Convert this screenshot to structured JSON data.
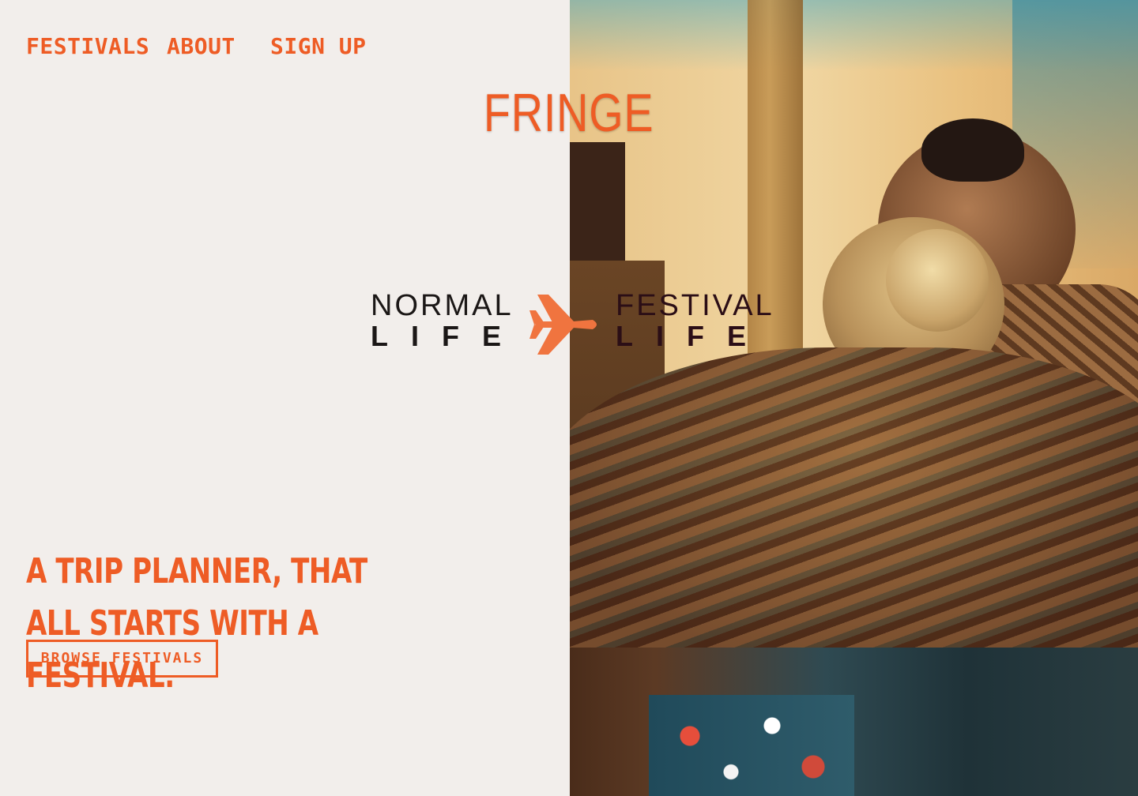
{
  "nav": {
    "items": [
      {
        "label": "FESTIVALS"
      },
      {
        "label": "ABOUT"
      },
      {
        "label": "SIGN UP"
      }
    ]
  },
  "brand": {
    "name": "FRINGE"
  },
  "transition": {
    "from_word": "NORMAL",
    "from_sub": "LIFE",
    "icon": "airplane-icon",
    "to_word": "FESTIVAL",
    "to_sub": "LIFE"
  },
  "hero": {
    "headline": "A TRIP PLANNER, THAT ALL STARTS WITH A FESTIVAL.",
    "cta_label": "BROWSE FESTIVALS"
  },
  "colors": {
    "accent": "#ee5c25",
    "background_left": "#f2eeeb",
    "text_dark": "#1b1716",
    "text_festival": "#2b0e16"
  }
}
